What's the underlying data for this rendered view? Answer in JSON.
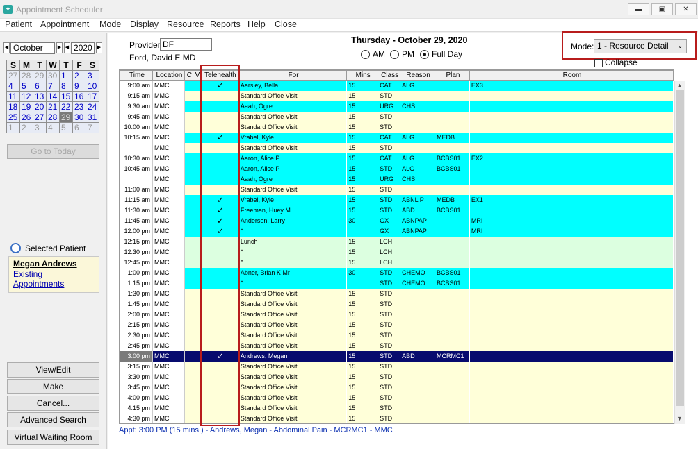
{
  "window": {
    "title": "Appointment Scheduler"
  },
  "menu": [
    "Patient",
    "Appointment",
    "Mode",
    "Display",
    "Resource",
    "Reports",
    "Help",
    "Close"
  ],
  "calendar": {
    "month": "October",
    "year": "2020",
    "day_headers": [
      "S",
      "M",
      "T",
      "W",
      "T",
      "F",
      "S"
    ],
    "weeks": [
      [
        "27",
        "28",
        "29",
        "30",
        "1",
        "2",
        "3"
      ],
      [
        "4",
        "5",
        "6",
        "7",
        "8",
        "9",
        "10"
      ],
      [
        "11",
        "12",
        "13",
        "14",
        "15",
        "16",
        "17"
      ],
      [
        "18",
        "19",
        "20",
        "21",
        "22",
        "23",
        "24"
      ],
      [
        "25",
        "26",
        "27",
        "28",
        "29",
        "30",
        "31"
      ],
      [
        "1",
        "2",
        "3",
        "4",
        "5",
        "6",
        "7"
      ]
    ],
    "selected_day": "29"
  },
  "go_today": "Go to Today",
  "selected_patient": {
    "heading": "Selected Patient",
    "name": "Megan Andrews",
    "link": "Existing Appointments"
  },
  "buttons": [
    "View/Edit",
    "Make",
    "Cancel...",
    "Advanced Search",
    "Virtual Waiting Room"
  ],
  "provider": {
    "label": "Provider:",
    "code": "DF",
    "name": "Ford, David E MD"
  },
  "date_heading": "Thursday - October  29, 2020",
  "day_options": [
    {
      "label": "AM",
      "checked": false
    },
    {
      "label": "PM",
      "checked": false
    },
    {
      "label": "Full Day",
      "checked": true
    }
  ],
  "mode": {
    "label": "Mode:",
    "value": "1 - Resource Detail"
  },
  "collapse_label": "Collapse",
  "columns": [
    "Time",
    "Location",
    "C",
    "V",
    "Telehealth",
    "For",
    "Mins",
    "Class",
    "Reason",
    "Plan",
    "Room"
  ],
  "rows": [
    {
      "time": "9:00 am",
      "loc": "MMC",
      "tele": "✓",
      "for": "Aarsley, Bella",
      "mins": "15",
      "cls": "CAT",
      "reason": "ALG",
      "plan": "",
      "room": "EX3",
      "color": "cyan"
    },
    {
      "time": "9:15 am",
      "loc": "MMC",
      "tele": "",
      "for": "Standard Office Visit",
      "mins": "15",
      "cls": "STD",
      "reason": "",
      "plan": "",
      "room": "",
      "color": "yellow"
    },
    {
      "time": "9:30 am",
      "loc": "MMC",
      "tele": "",
      "for": "Aaah, Ogre",
      "mins": "15",
      "cls": "URG",
      "reason": "CHS",
      "plan": "",
      "room": "",
      "color": "cyan"
    },
    {
      "time": "9:45 am",
      "loc": "MMC",
      "tele": "",
      "for": "Standard Office Visit",
      "mins": "15",
      "cls": "STD",
      "reason": "",
      "plan": "",
      "room": "",
      "color": "yellow"
    },
    {
      "time": "10:00 am",
      "loc": "MMC",
      "tele": "",
      "for": "Standard Office Visit",
      "mins": "15",
      "cls": "STD",
      "reason": "",
      "plan": "",
      "room": "",
      "color": "yellow"
    },
    {
      "time": "10:15 am",
      "loc": "MMC",
      "tele": "✓",
      "for": "Vrabel, Kyle",
      "mins": "15",
      "cls": "CAT",
      "reason": "ALG",
      "plan": "MEDB",
      "room": "",
      "color": "cyan"
    },
    {
      "time": "",
      "loc": "MMC",
      "tele": "",
      "for": "Standard Office Visit",
      "mins": "15",
      "cls": "STD",
      "reason": "",
      "plan": "",
      "room": "",
      "color": "yellow"
    },
    {
      "time": "10:30 am",
      "loc": "MMC",
      "tele": "",
      "for": "Aaron, Alice P",
      "mins": "15",
      "cls": "CAT",
      "reason": "ALG",
      "plan": "BCBS01",
      "room": "EX2",
      "color": "cyan"
    },
    {
      "time": "10:45 am",
      "loc": "MMC",
      "tele": "",
      "for": "Aaron, Alice P",
      "mins": "15",
      "cls": "STD",
      "reason": "ALG",
      "plan": "BCBS01",
      "room": "",
      "color": "cyan"
    },
    {
      "time": "",
      "loc": "MMC",
      "tele": "",
      "for": "Aaah, Ogre",
      "mins": "15",
      "cls": "URG",
      "reason": "CHS",
      "plan": "",
      "room": "",
      "color": "cyan"
    },
    {
      "time": "11:00 am",
      "loc": "MMC",
      "tele": "",
      "for": "Standard Office Visit",
      "mins": "15",
      "cls": "STD",
      "reason": "",
      "plan": "",
      "room": "",
      "color": "yellow"
    },
    {
      "time": "11:15 am",
      "loc": "MMC",
      "tele": "✓",
      "for": "Vrabel, Kyle",
      "mins": "15",
      "cls": "STD",
      "reason": "ABNL P",
      "plan": "MEDB",
      "room": "EX1",
      "color": "cyan"
    },
    {
      "time": "11:30 am",
      "loc": "MMC",
      "tele": "✓",
      "for": "Freeman, Huey M",
      "mins": "15",
      "cls": "STD",
      "reason": "ABD",
      "plan": "BCBS01",
      "room": "",
      "color": "cyan"
    },
    {
      "time": "11:45 am",
      "loc": "MMC",
      "tele": "✓",
      "for": "Anderson, Larry",
      "mins": "30",
      "cls": "GX",
      "reason": "ABNPAP",
      "plan": "",
      "room": "MRI",
      "color": "cyan"
    },
    {
      "time": "12:00 pm",
      "loc": "MMC",
      "tele": "✓",
      "for": "^",
      "mins": "",
      "cls": "GX",
      "reason": "ABNPAP",
      "plan": "",
      "room": "MRI",
      "color": "cyan"
    },
    {
      "time": "12:15 pm",
      "loc": "MMC",
      "tele": "",
      "for": "Lunch",
      "mins": "15",
      "cls": "LCH",
      "reason": "",
      "plan": "",
      "room": "",
      "color": "green"
    },
    {
      "time": "12:30 pm",
      "loc": "MMC",
      "tele": "",
      "for": "^",
      "mins": "15",
      "cls": "LCH",
      "reason": "",
      "plan": "",
      "room": "",
      "color": "green"
    },
    {
      "time": "12:45 pm",
      "loc": "MMC",
      "tele": "",
      "for": "^",
      "mins": "15",
      "cls": "LCH",
      "reason": "",
      "plan": "",
      "room": "",
      "color": "green"
    },
    {
      "time": "1:00 pm",
      "loc": "MMC",
      "tele": "",
      "for": "Abner, Brian K Mr",
      "mins": "30",
      "cls": "STD",
      "reason": "CHEMO",
      "plan": "BCBS01",
      "room": "",
      "color": "cyan"
    },
    {
      "time": "1:15 pm",
      "loc": "MMC",
      "tele": "",
      "for": "^",
      "mins": "",
      "cls": "STD",
      "reason": "CHEMO",
      "plan": "BCBS01",
      "room": "",
      "color": "cyan"
    },
    {
      "time": "1:30 pm",
      "loc": "MMC",
      "tele": "",
      "for": "Standard Office Visit",
      "mins": "15",
      "cls": "STD",
      "reason": "",
      "plan": "",
      "room": "",
      "color": "yellow"
    },
    {
      "time": "1:45 pm",
      "loc": "MMC",
      "tele": "",
      "for": "Standard Office Visit",
      "mins": "15",
      "cls": "STD",
      "reason": "",
      "plan": "",
      "room": "",
      "color": "yellow"
    },
    {
      "time": "2:00 pm",
      "loc": "MMC",
      "tele": "",
      "for": "Standard Office Visit",
      "mins": "15",
      "cls": "STD",
      "reason": "",
      "plan": "",
      "room": "",
      "color": "yellow"
    },
    {
      "time": "2:15 pm",
      "loc": "MMC",
      "tele": "",
      "for": "Standard Office Visit",
      "mins": "15",
      "cls": "STD",
      "reason": "",
      "plan": "",
      "room": "",
      "color": "yellow"
    },
    {
      "time": "2:30 pm",
      "loc": "MMC",
      "tele": "",
      "for": "Standard Office Visit",
      "mins": "15",
      "cls": "STD",
      "reason": "",
      "plan": "",
      "room": "",
      "color": "yellow"
    },
    {
      "time": "2:45 pm",
      "loc": "MMC",
      "tele": "",
      "for": "Standard Office Visit",
      "mins": "15",
      "cls": "STD",
      "reason": "",
      "plan": "",
      "room": "",
      "color": "yellow"
    },
    {
      "time": "3:00 pm",
      "loc": "MMC",
      "tele": "✓",
      "for": "Andrews, Megan",
      "mins": "15",
      "cls": "STD",
      "reason": "ABD",
      "plan": "MCRMC1",
      "room": "",
      "color": "sel"
    },
    {
      "time": "3:15 pm",
      "loc": "MMC",
      "tele": "",
      "for": "Standard Office Visit",
      "mins": "15",
      "cls": "STD",
      "reason": "",
      "plan": "",
      "room": "",
      "color": "yellow"
    },
    {
      "time": "3:30 pm",
      "loc": "MMC",
      "tele": "",
      "for": "Standard Office Visit",
      "mins": "15",
      "cls": "STD",
      "reason": "",
      "plan": "",
      "room": "",
      "color": "yellow"
    },
    {
      "time": "3:45 pm",
      "loc": "MMC",
      "tele": "",
      "for": "Standard Office Visit",
      "mins": "15",
      "cls": "STD",
      "reason": "",
      "plan": "",
      "room": "",
      "color": "yellow"
    },
    {
      "time": "4:00 pm",
      "loc": "MMC",
      "tele": "",
      "for": "Standard Office Visit",
      "mins": "15",
      "cls": "STD",
      "reason": "",
      "plan": "",
      "room": "",
      "color": "yellow"
    },
    {
      "time": "4:15 pm",
      "loc": "MMC",
      "tele": "",
      "for": "Standard Office Visit",
      "mins": "15",
      "cls": "STD",
      "reason": "",
      "plan": "",
      "room": "",
      "color": "yellow"
    },
    {
      "time": "4:30 pm",
      "loc": "MMC",
      "tele": "",
      "for": "Standard Office Visit",
      "mins": "15",
      "cls": "STD",
      "reason": "",
      "plan": "",
      "room": "",
      "color": "yellow"
    }
  ],
  "status_line": "Appt: 3:00 PM (15 mins.) - Andrews, Megan - Abdominal Pain - MCRMC1 - MMC",
  "colors": {
    "highlight_box": "#b81c1c",
    "row_cyan": "#00ffff",
    "row_yellow": "#ffffd9",
    "row_green": "#dcffe0",
    "row_selected": "#070b6e",
    "calendar_link": "#0000c8"
  }
}
